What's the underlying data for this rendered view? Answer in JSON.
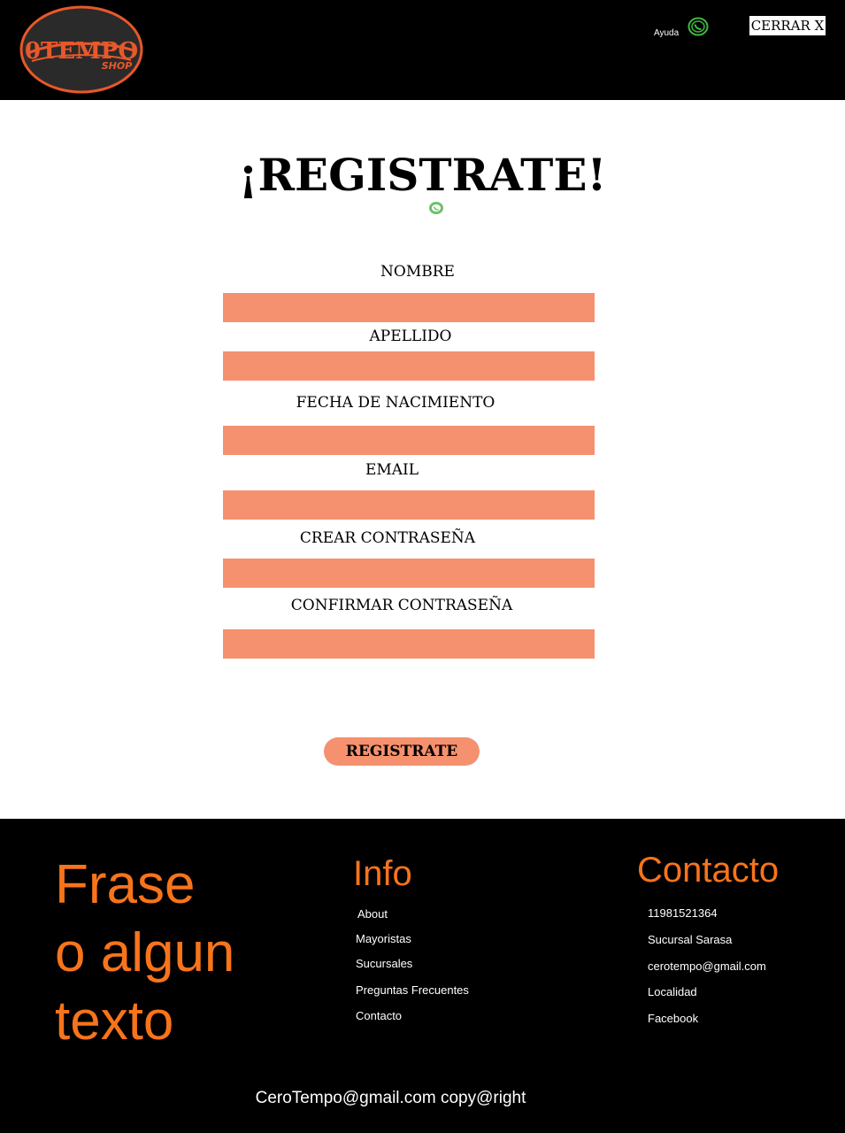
{
  "header": {
    "logo_main": "0TEMPO",
    "logo_sub": "SHOP",
    "help_label": "Ayuda",
    "close_label": "CERRAR X"
  },
  "form": {
    "title": "¡REGISTRATE!",
    "fields": [
      {
        "label": "NOMBRE",
        "value": ""
      },
      {
        "label": "APELLIDO",
        "value": ""
      },
      {
        "label": "FECHA DE NACIMIENTO",
        "value": ""
      },
      {
        "label": "EMAIL",
        "value": ""
      },
      {
        "label": "CREAR CONTRASEÑA",
        "value": ""
      },
      {
        "label": "CONFIRMAR CONTRASEÑA",
        "value": ""
      }
    ],
    "submit_label": "REGISTRATE"
  },
  "footer": {
    "phrase_lines": [
      "Frase",
      "o algun",
      "texto"
    ],
    "info_heading": "Info",
    "info_links": [
      "About",
      "Mayoristas",
      "Sucursales",
      "Preguntas Frecuentes",
      "Contacto"
    ],
    "contact_heading": "Contacto",
    "contact_items": [
      "11981521364",
      "Sucursal Sarasa",
      "cerotempo@gmail.com",
      "Localidad",
      "Facebook"
    ],
    "copyright": "CeroTempo@gmail.com copy@right"
  },
  "colors": {
    "accent": "#f5916e",
    "footer_accent": "#f7741b",
    "header_bg": "#000000",
    "help_icon": "#3fb83f"
  },
  "icons": {
    "help": "whatsapp-icon",
    "title": "whatsapp-icon"
  }
}
